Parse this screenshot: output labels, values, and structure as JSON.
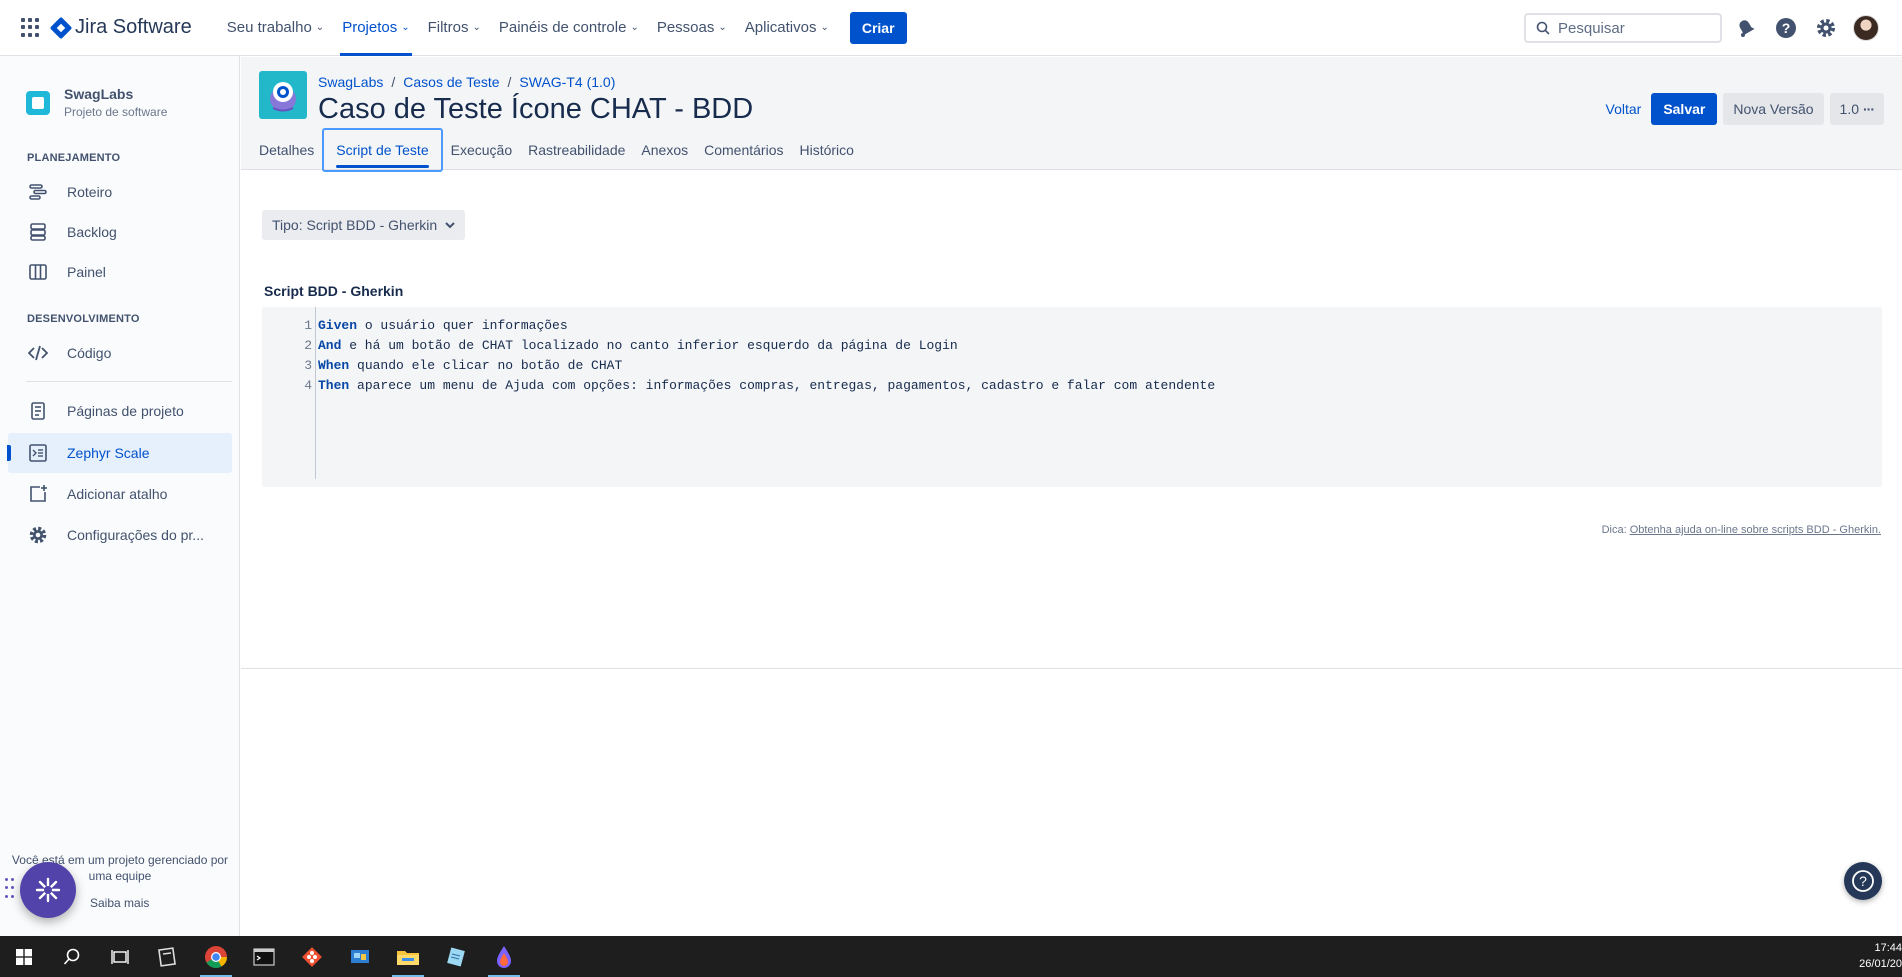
{
  "topnav": {
    "logo_text": "Jira Software",
    "items": [
      {
        "label": "Seu trabalho"
      },
      {
        "label": "Projetos"
      },
      {
        "label": "Filtros"
      },
      {
        "label": "Painéis de controle"
      },
      {
        "label": "Pessoas"
      },
      {
        "label": "Aplicativos"
      }
    ],
    "create_label": "Criar",
    "search_placeholder": "Pesquisar",
    "accent": "#0052CC"
  },
  "sidebar": {
    "project_name": "SwagLabs",
    "project_type": "Projeto de software",
    "planning_header": "PLANEJAMENTO",
    "planning_items": [
      {
        "label": "Roteiro",
        "icon": "roadmap-icon"
      },
      {
        "label": "Backlog",
        "icon": "backlog-icon"
      },
      {
        "label": "Painel",
        "icon": "board-icon"
      }
    ],
    "dev_header": "DESENVOLVIMENTO",
    "dev_items": [
      {
        "label": "Código",
        "icon": "code-icon"
      }
    ],
    "other_items": [
      {
        "label": "Páginas de projeto",
        "icon": "page-icon"
      },
      {
        "label": "Zephyr Scale",
        "icon": "zephyr-icon"
      },
      {
        "label": "Adicionar atalho",
        "icon": "add-shortcut-icon"
      },
      {
        "label": "Configurações do pr...",
        "icon": "settings-icon"
      }
    ],
    "managed_text": "Você está em um projeto gerenciado por uma equipe",
    "learn_more": "Saiba mais"
  },
  "header": {
    "breadcrumbs": [
      "SwagLabs",
      "Casos de Teste",
      "SWAG-T4 (1.0)"
    ],
    "title": "Caso de Teste Ícone CHAT - BDD",
    "actions": {
      "back": "Voltar",
      "save": "Salvar",
      "new_version": "Nova Versão",
      "version": "1.0"
    },
    "tabs": [
      {
        "label": "Detalhes"
      },
      {
        "label": "Script de Teste"
      },
      {
        "label": "Execução"
      },
      {
        "label": "Rastreabilidade"
      },
      {
        "label": "Anexos"
      },
      {
        "label": "Comentários"
      },
      {
        "label": "Histórico"
      }
    ]
  },
  "content": {
    "type_select": "Tipo: Script BDD - Gherkin",
    "script_title": "Script BDD - Gherkin",
    "script_lines": [
      {
        "num": "1",
        "keyword": "Given",
        "text": " o usuário quer informações"
      },
      {
        "num": "2",
        "keyword": "And",
        "text": " e há um botão de CHAT localizado no canto inferior esquerdo da página de Login"
      },
      {
        "num": "3",
        "keyword": "When",
        "text": " quando ele clicar no botão de CHAT"
      },
      {
        "num": "4",
        "keyword": "Then",
        "text": " aparece um menu de Ajuda com opções: informações compras, entregas, pagamentos, cadastro e falar com atendente"
      }
    ],
    "hint_prefix": "Dica:",
    "hint_link": "Obtenha ajuda on-line sobre scripts BDD - Gherkin."
  },
  "taskbar": {
    "time": "17:44",
    "date": "26/01/20"
  }
}
